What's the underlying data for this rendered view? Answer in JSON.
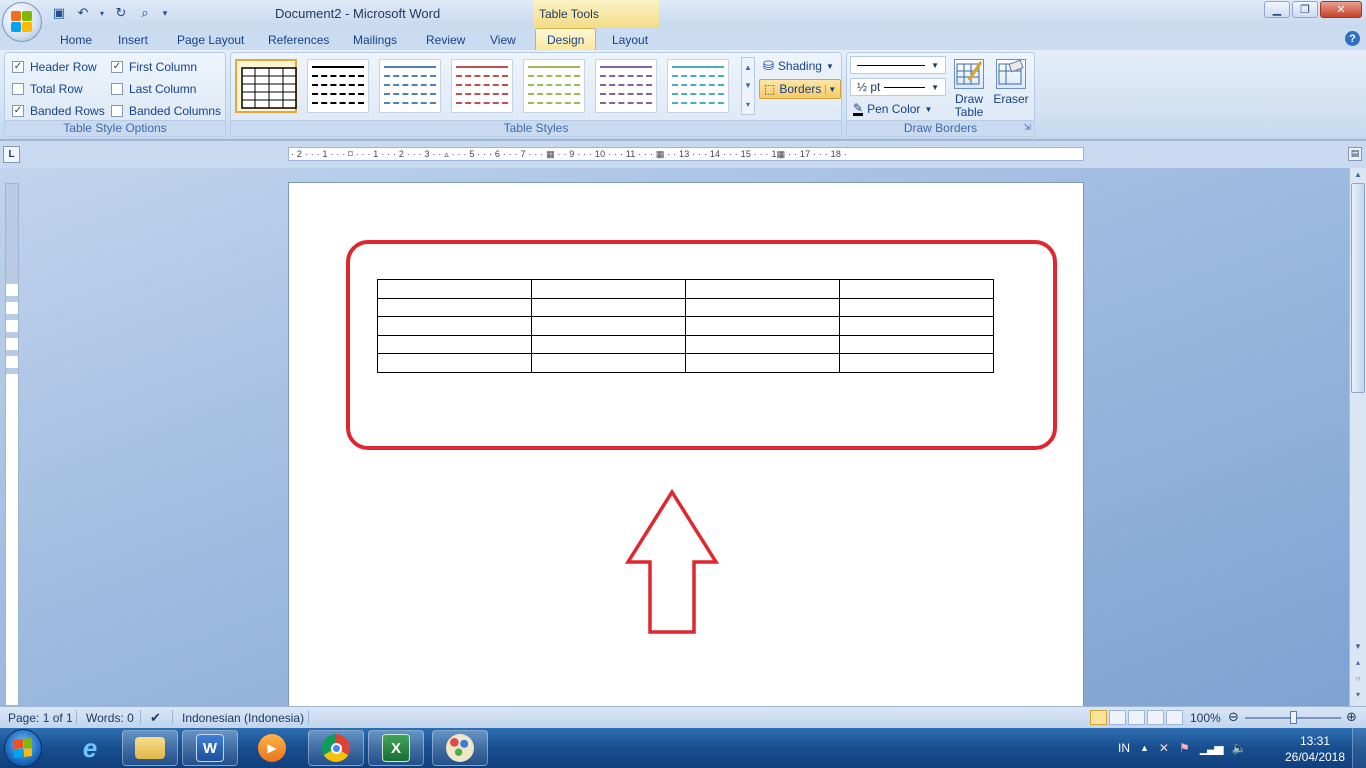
{
  "window": {
    "title": "Document2 - Microsoft Word",
    "context_tab_group": "Table Tools"
  },
  "tabs": [
    {
      "label": "Home",
      "active": false
    },
    {
      "label": "Insert",
      "active": false
    },
    {
      "label": "Page Layout",
      "active": false
    },
    {
      "label": "References",
      "active": false
    },
    {
      "label": "Mailings",
      "active": false
    },
    {
      "label": "Review",
      "active": false
    },
    {
      "label": "View",
      "active": false
    },
    {
      "label": "Design",
      "active": true
    },
    {
      "label": "Layout",
      "active": false
    }
  ],
  "ribbon": {
    "table_style_options": {
      "label": "Table Style Options",
      "options": [
        {
          "label": "Header Row",
          "checked": true
        },
        {
          "label": "Total Row",
          "checked": false
        },
        {
          "label": "Banded Rows",
          "checked": true
        },
        {
          "label": "First Column",
          "checked": true
        },
        {
          "label": "Last Column",
          "checked": false
        },
        {
          "label": "Banded Columns",
          "checked": false
        }
      ]
    },
    "table_styles": {
      "label": "Table Styles",
      "thumbnail_colors": [
        "#000000",
        "#000000",
        "#4f81bd",
        "#c0504d",
        "#9bbb59",
        "#8064a2",
        "#4bacc6"
      ],
      "shading_label": "Shading",
      "borders_label": "Borders"
    },
    "draw_borders": {
      "label": "Draw Borders",
      "pen_weight": "½ pt",
      "pen_color_label": "Pen Color",
      "draw_table_label": "Draw Table",
      "eraser_label": "Eraser"
    }
  },
  "ruler": {
    "horizontal": "· 2 · · · 1 · · · ⌑ · · · 1 · · · 2 · · · 3 · · ▵ · · · 5 · · · 6 · · · 7 · · · ▦ · · 9 · · · 10 · · · 11 · · · ▦ · · 13 · · · 14 · · · 15 · · · 1▦ · · 17 · · · 18 ·"
  },
  "document": {
    "table_rows": 5,
    "table_cols": 4
  },
  "colors": {
    "highlight": "#e0262f"
  },
  "statusbar": {
    "page": "Page: 1 of 1",
    "words": "Words: 0",
    "language": "Indonesian (Indonesia)",
    "zoom": "100%",
    "zoom_percent": 100
  },
  "taskbar": {
    "apps": [
      {
        "name": "internet-explorer",
        "open": false
      },
      {
        "name": "file-explorer",
        "open": true
      },
      {
        "name": "microsoft-word",
        "open": true
      },
      {
        "name": "media-player",
        "open": false
      },
      {
        "name": "google-chrome",
        "open": true
      },
      {
        "name": "microsoft-excel",
        "open": true
      },
      {
        "name": "paint",
        "open": true
      }
    ],
    "input_language": "IN",
    "time": "13:31",
    "date": "26/04/2018"
  }
}
